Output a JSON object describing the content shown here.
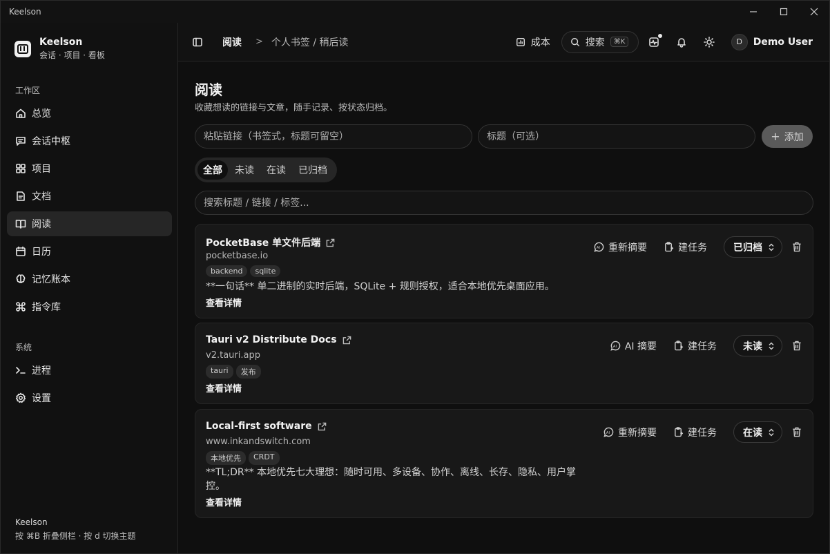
{
  "window": {
    "title": "Keelson"
  },
  "brand": {
    "name": "Keelson",
    "subtitle": "会话 · 项目 · 看板"
  },
  "sidebar": {
    "workspace_label": "工作区",
    "workspace_items": [
      {
        "label": "总览",
        "icon": "home-icon"
      },
      {
        "label": "会话中枢",
        "icon": "chat-icon"
      },
      {
        "label": "项目",
        "icon": "grid-icon"
      },
      {
        "label": "文档",
        "icon": "document-icon"
      },
      {
        "label": "阅读",
        "icon": "book-icon",
        "active": true
      },
      {
        "label": "日历",
        "icon": "calendar-icon"
      },
      {
        "label": "记忆账本",
        "icon": "brain-icon"
      },
      {
        "label": "指令库",
        "icon": "command-icon"
      }
    ],
    "system_label": "系统",
    "system_items": [
      {
        "label": "进程",
        "icon": "terminal-icon"
      },
      {
        "label": "设置",
        "icon": "gear-icon"
      }
    ],
    "footer": {
      "title": "Keelson",
      "hint": "按 ⌘B 折叠侧栏 · 按 d 切换主题"
    }
  },
  "header": {
    "breadcrumb_current": "阅读",
    "breadcrumb_sep": ">",
    "breadcrumb_page": "个人书签 / 稍后读",
    "cost_label": "成本",
    "search_label": "搜索",
    "search_kbd": "⌘K",
    "user_initial": "D",
    "user_name": "Demo User"
  },
  "main": {
    "title": "阅读",
    "subtitle": "收藏想读的链接与文章，随手记录、按状态归档。",
    "link_placeholder": "粘贴链接（书签式，标题可留空）",
    "title_placeholder": "标题（可选）",
    "add_label": "添加",
    "tabs": [
      {
        "label": "全部",
        "active": true
      },
      {
        "label": "未读"
      },
      {
        "label": "在读"
      },
      {
        "label": "已归档"
      }
    ],
    "search_placeholder": "搜索标题 / 链接 / 标签..."
  },
  "items": [
    {
      "title": "PocketBase 单文件后端",
      "domain": "pocketbase.io",
      "tags": [
        "backend",
        "sqlite"
      ],
      "summary": "**一句话** 单二进制的实时后端，SQLite + 规则授权，适合本地优先桌面应用。",
      "details": "查看详情",
      "ai_action": "重新摘要",
      "task_action": "建任务",
      "status": "已归档"
    },
    {
      "title": "Tauri v2 Distribute Docs",
      "domain": "v2.tauri.app",
      "tags": [
        "tauri",
        "发布"
      ],
      "summary": "",
      "details": "查看详情",
      "ai_action": "AI 摘要",
      "task_action": "建任务",
      "status": "未读"
    },
    {
      "title": "Local-first software",
      "domain": "www.inkandswitch.com",
      "tags": [
        "本地优先",
        "CRDT"
      ],
      "summary": "**TL;DR** 本地优先七大理想：随时可用、多设备、协作、离线、长存、隐私、用户掌控。",
      "details": "查看详情",
      "ai_action": "重新摘要",
      "task_action": "建任务",
      "status": "在读"
    }
  ]
}
